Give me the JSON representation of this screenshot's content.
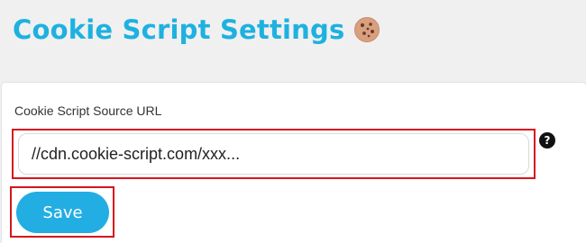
{
  "header": {
    "title": "Cookie Script Settings",
    "icon": "cookie-icon"
  },
  "form": {
    "url_label": "Cookie Script Source URL",
    "url_value": "//cdn.cookie-script.com/xxx...",
    "url_placeholder": "",
    "help_label": "?",
    "save_label": "Save"
  },
  "colors": {
    "title": "#1eb1e0",
    "save_button": "#22aee3",
    "highlight": "#d6141d"
  }
}
